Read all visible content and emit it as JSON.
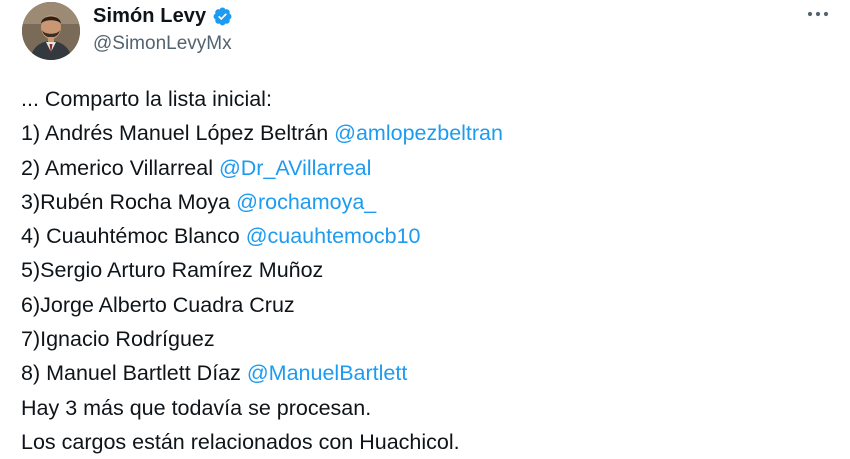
{
  "author": {
    "display_name": "Simón Levy",
    "handle": "@SimonLevyMx",
    "verified": true,
    "avatar": "profile-photo"
  },
  "colors": {
    "link": "#1d9bf0",
    "text": "#0f1419",
    "secondary": "#536471",
    "verified_badge": "#1d9bf0"
  },
  "icons": {
    "verified": "verified-badge-icon",
    "more": "more-options-icon"
  },
  "tweet": {
    "lines": [
      {
        "text": "... Comparto la lista inicial:",
        "mention": ""
      },
      {
        "text": "1) Andrés Manuel López Beltrán ",
        "mention": "@amlopezbeltran"
      },
      {
        "text": "2) Americo Villarreal ",
        "mention": "@Dr_AVillarreal"
      },
      {
        "text": "3)Rubén Rocha Moya ",
        "mention": "@rochamoya_"
      },
      {
        "text": "4) Cuauhtémoc Blanco ",
        "mention": "@cuauhtemocb10"
      },
      {
        "text": "5)Sergio Arturo Ramírez Muñoz",
        "mention": ""
      },
      {
        "text": "6)Jorge Alberto Cuadra Cruz",
        "mention": ""
      },
      {
        "text": "7)Ignacio Rodríguez",
        "mention": ""
      },
      {
        "text": "8) Manuel Bartlett Díaz ",
        "mention": "@ManuelBartlett"
      },
      {
        "text": "Hay 3 más que todavía se procesan.",
        "mention": ""
      },
      {
        "text": "Los cargos están relacionados con Huachicol.",
        "mention": ""
      }
    ]
  }
}
